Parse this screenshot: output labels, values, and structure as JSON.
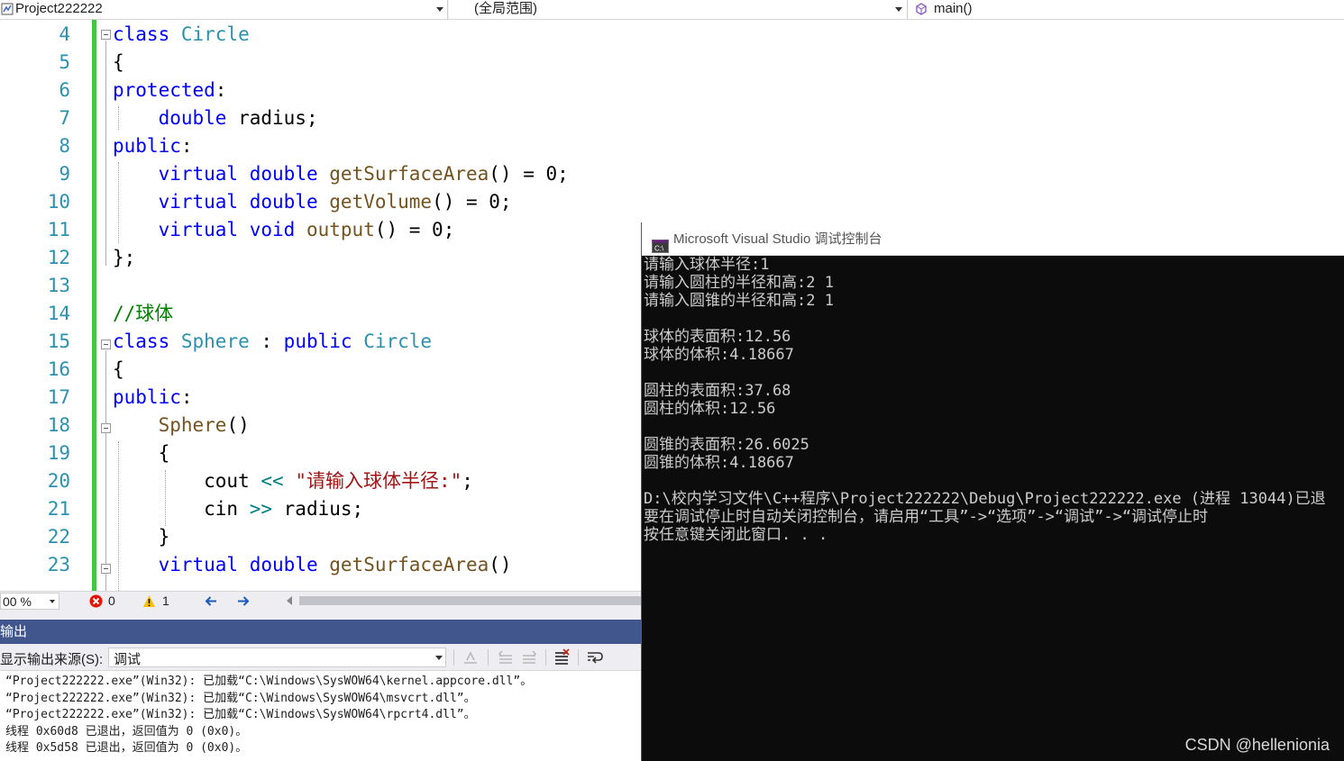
{
  "navbar": {
    "project": "Project222222",
    "scope": "(全局范围)",
    "member": "main()"
  },
  "editor": {
    "lines": [
      {
        "num": "4"
      },
      {
        "num": "5"
      },
      {
        "num": "6"
      },
      {
        "num": "7"
      },
      {
        "num": "8"
      },
      {
        "num": "9"
      },
      {
        "num": "10"
      },
      {
        "num": "11"
      },
      {
        "num": "12"
      },
      {
        "num": "13"
      },
      {
        "num": "14"
      },
      {
        "num": "15"
      },
      {
        "num": "16"
      },
      {
        "num": "17"
      },
      {
        "num": "18"
      },
      {
        "num": "19"
      },
      {
        "num": "20"
      },
      {
        "num": "21"
      },
      {
        "num": "22"
      },
      {
        "num": "23"
      }
    ],
    "code": [
      [
        {
          "c": "kw",
          "t": "class"
        },
        {
          "c": "",
          "t": " "
        },
        {
          "c": "ty",
          "t": "Circle"
        }
      ],
      [
        {
          "c": "",
          "t": "{"
        }
      ],
      [
        {
          "c": "kw",
          "t": "protected"
        },
        {
          "c": "",
          "t": ":"
        }
      ],
      [
        {
          "c": "",
          "t": "    "
        },
        {
          "c": "kw",
          "t": "double"
        },
        {
          "c": "",
          "t": " radius;"
        }
      ],
      [
        {
          "c": "kw",
          "t": "public"
        },
        {
          "c": "",
          "t": ":"
        }
      ],
      [
        {
          "c": "",
          "t": "    "
        },
        {
          "c": "kw",
          "t": "virtual"
        },
        {
          "c": "",
          "t": " "
        },
        {
          "c": "kw",
          "t": "double"
        },
        {
          "c": "",
          "t": " "
        },
        {
          "c": "fn",
          "t": "getSurfaceArea"
        },
        {
          "c": "",
          "t": "() = 0;"
        }
      ],
      [
        {
          "c": "",
          "t": "    "
        },
        {
          "c": "kw",
          "t": "virtual"
        },
        {
          "c": "",
          "t": " "
        },
        {
          "c": "kw",
          "t": "double"
        },
        {
          "c": "",
          "t": " "
        },
        {
          "c": "fn",
          "t": "getVolume"
        },
        {
          "c": "",
          "t": "() = 0;"
        }
      ],
      [
        {
          "c": "",
          "t": "    "
        },
        {
          "c": "kw",
          "t": "virtual"
        },
        {
          "c": "",
          "t": " "
        },
        {
          "c": "kw",
          "t": "void"
        },
        {
          "c": "",
          "t": " "
        },
        {
          "c": "fn",
          "t": "output"
        },
        {
          "c": "",
          "t": "() = 0;"
        }
      ],
      [
        {
          "c": "",
          "t": "};"
        }
      ],
      [
        {
          "c": "",
          "t": ""
        }
      ],
      [
        {
          "c": "cm",
          "t": "//球体"
        }
      ],
      [
        {
          "c": "kw",
          "t": "class"
        },
        {
          "c": "",
          "t": " "
        },
        {
          "c": "ty",
          "t": "Sphere"
        },
        {
          "c": "",
          "t": " : "
        },
        {
          "c": "kw",
          "t": "public"
        },
        {
          "c": "",
          "t": " "
        },
        {
          "c": "ty",
          "t": "Circle"
        }
      ],
      [
        {
          "c": "",
          "t": "{"
        }
      ],
      [
        {
          "c": "kw",
          "t": "public"
        },
        {
          "c": "",
          "t": ":"
        }
      ],
      [
        {
          "c": "",
          "t": "    "
        },
        {
          "c": "fn",
          "t": "Sphere"
        },
        {
          "c": "",
          "t": "()"
        }
      ],
      [
        {
          "c": "",
          "t": "    {"
        }
      ],
      [
        {
          "c": "",
          "t": "        cout "
        },
        {
          "c": "op",
          "t": "<<"
        },
        {
          "c": "",
          "t": " "
        },
        {
          "c": "st",
          "t": "\"请输入球体半径:\""
        },
        {
          "c": "",
          "t": ";"
        }
      ],
      [
        {
          "c": "",
          "t": "        cin "
        },
        {
          "c": "op",
          "t": ">>"
        },
        {
          "c": "",
          "t": " radius;"
        }
      ],
      [
        {
          "c": "",
          "t": "    }"
        }
      ],
      [
        {
          "c": "",
          "t": "    "
        },
        {
          "c": "kw",
          "t": "virtual"
        },
        {
          "c": "",
          "t": " "
        },
        {
          "c": "kw",
          "t": "double"
        },
        {
          "c": "",
          "t": " "
        },
        {
          "c": "fn",
          "t": "getSurfaceArea"
        },
        {
          "c": "",
          "t": "()"
        }
      ]
    ]
  },
  "status": {
    "zoom": "00 %",
    "errors": "0",
    "warnings": "1"
  },
  "output": {
    "title": "输出",
    "source_label": "显示输出来源(S):",
    "source_value": "调试",
    "lines": [
      "“Project222222.exe”(Win32): 已加载“C:\\Windows\\SysWOW64\\kernel.appcore.dll”。",
      "“Project222222.exe”(Win32): 已加载“C:\\Windows\\SysWOW64\\msvcrt.dll”。",
      "“Project222222.exe”(Win32): 已加载“C:\\Windows\\SysWOW64\\rpcrt4.dll”。",
      "线程 0x60d8 已退出，返回值为 0 (0x0)。",
      "线程 0x5d58 已退出，返回值为 0 (0x0)。"
    ]
  },
  "console": {
    "title": "Microsoft Visual Studio 调试控制台",
    "lines": [
      "请输入球体半径:1",
      "请输入圆柱的半径和高:2 1",
      "请输入圆锥的半径和高:2 1",
      "",
      "球体的表面积:12.56",
      "球体的体积:4.18667",
      "",
      "圆柱的表面积:37.68",
      "圆柱的体积:12.56",
      "",
      "圆锥的表面积:26.6025",
      "圆锥的体积:4.18667",
      "",
      "D:\\校内学习文件\\C++程序\\Project222222\\Debug\\Project222222.exe (进程 13044)已退",
      "要在调试停止时自动关闭控制台，请启用“工具”->“选项”->“调试”->“调试停止时",
      "按任意键关闭此窗口. . ."
    ],
    "watermark": "CSDN @hellenionia"
  },
  "colors": {
    "keyword": "#0000ff",
    "type": "#2b91af",
    "function": "#74531f",
    "comment": "#008000",
    "string": "#a31515",
    "change_bar": "#45c544",
    "output_header": "#40568d",
    "console_bg": "#0c0c0c"
  },
  "icons": [
    "project-icon",
    "member-icon",
    "error-icon",
    "warning-icon",
    "nav-back-icon",
    "nav-forward-icon",
    "console-app-icon"
  ]
}
